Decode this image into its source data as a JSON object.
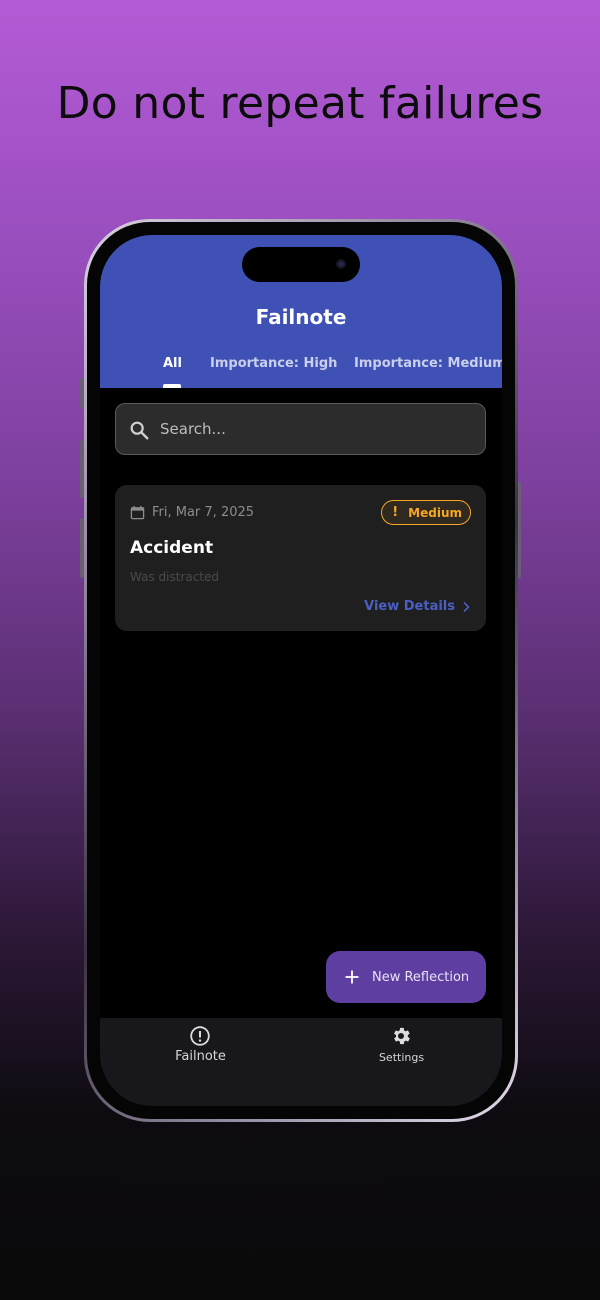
{
  "headline": "Do not repeat failures",
  "app": {
    "title": "Failnote",
    "tabs": [
      {
        "label": "All",
        "active": true
      },
      {
        "label": "Importance: High",
        "active": false
      },
      {
        "label": "Importance: Medium",
        "active": false
      }
    ]
  },
  "search": {
    "placeholder": "Search...",
    "value": ""
  },
  "entries": [
    {
      "date": "Fri, Mar 7, 2025",
      "importance": "Medium",
      "title": "Accident",
      "description": "Was distracted",
      "link_label": "View Details"
    }
  ],
  "fab": {
    "label": "New Reflection",
    "icon": "plus-icon"
  },
  "bottom_nav": [
    {
      "label": "Failnote",
      "icon": "alert-circle-icon",
      "active": true
    },
    {
      "label": "Settings",
      "icon": "gear-icon",
      "active": false
    }
  ],
  "colors": {
    "primary": "#3f51b5",
    "fab": "#5e3ea1",
    "badge_medium": "#f5a623",
    "link": "#4a5fc4",
    "card_bg": "#1f1f1f"
  }
}
